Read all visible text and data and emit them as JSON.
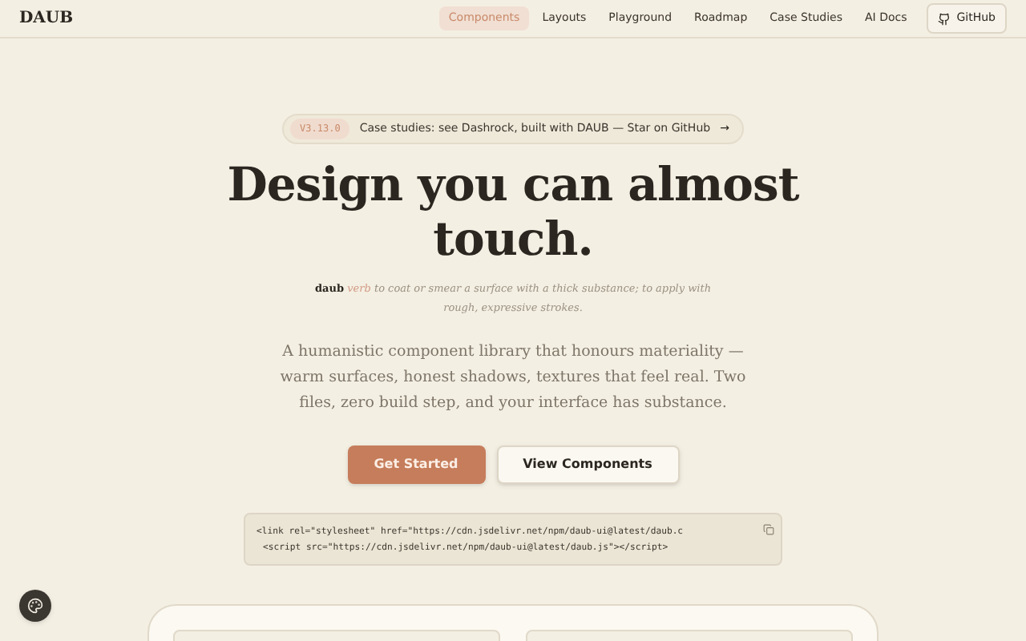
{
  "nav": {
    "logo": "DAUB",
    "links": [
      {
        "label": "Components",
        "selected": true
      },
      {
        "label": "Layouts",
        "selected": false
      },
      {
        "label": "Playground",
        "selected": false
      },
      {
        "label": "Roadmap",
        "selected": false
      },
      {
        "label": "Case Studies",
        "selected": false
      },
      {
        "label": "AI Docs",
        "selected": false
      }
    ],
    "github": "GitHub"
  },
  "announcement": {
    "version": "V3.13.0",
    "text": "Case studies: see Dashrock, built with DAUB — Star on GitHub",
    "arrow": "→"
  },
  "hero": {
    "title_lines": [
      "Design you can almost",
      "touch."
    ],
    "definition": {
      "word": "daub",
      "pos": "verb",
      "text": "to coat or smear a surface with a thick substance; to apply with rough, expressive strokes."
    },
    "lead": "A humanistic component library that honours materiality — warm surfaces, honest shadows, textures that feel real. Two files, zero build step, and your interface has substance.",
    "buttons": [
      {
        "label": "Get Started",
        "kind": "primary"
      },
      {
        "label": "View Components",
        "kind": "secondary"
      }
    ]
  },
  "code": {
    "lines": [
      "<link rel=\"stylesheet\" href=\"https://cdn.jsdelivr.net/npm/daub-ui@latest/daub.c",
      "<script src=\"https://cdn.jsdelivr.net/npm/daub-ui@latest/daub.js\"></script>"
    ]
  }
}
